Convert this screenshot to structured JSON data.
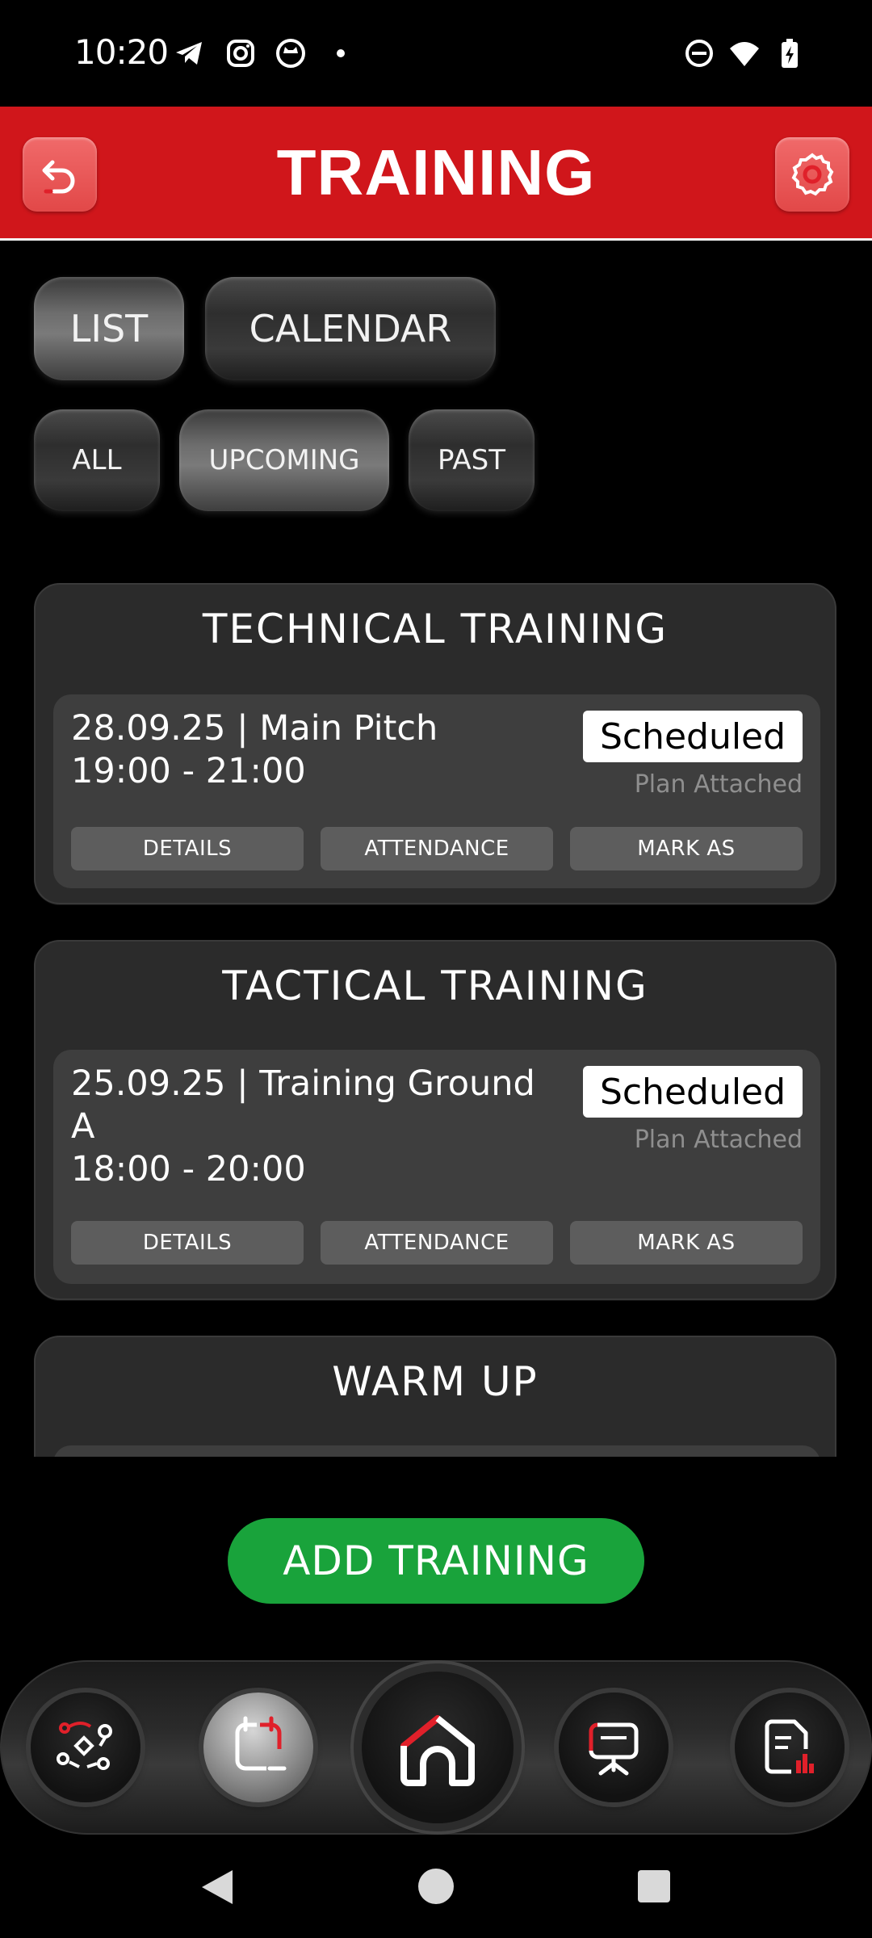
{
  "status_bar": {
    "time": "10:20"
  },
  "header": {
    "title": "TRAINING"
  },
  "view_toggle": {
    "list": "LIST",
    "calendar": "CALENDAR"
  },
  "filters": {
    "all": "ALL",
    "upcoming": "UPCOMING",
    "past": "PAST"
  },
  "trainings": [
    {
      "title": "TECHNICAL TRAINING",
      "date_location": "28.09.25 | Main Pitch",
      "time": "19:00 - 21:00",
      "status": "Scheduled",
      "plan": "Plan Attached",
      "buttons": {
        "details": "DETAILS",
        "attendance": "ATTENDANCE",
        "mark_as": "MARK AS"
      }
    },
    {
      "title": "TACTICAL TRAINING",
      "date_location": "25.09.25 | Training Ground",
      "date_location_cont": "A",
      "time": "18:00 - 20:00",
      "status": "Scheduled",
      "plan": "Plan Attached",
      "buttons": {
        "details": "DETAILS",
        "attendance": "ATTENDANCE",
        "mark_as": "MARK AS"
      }
    },
    {
      "title": "WARM UP"
    }
  ],
  "add_training": "ADD TRAINING",
  "icons": {
    "back": "back-arrow-icon",
    "settings": "gear-icon",
    "nav": [
      "tactics-icon",
      "schedule-icon",
      "home-icon",
      "presentation-icon",
      "report-icon"
    ]
  },
  "colors": {
    "header_red": "#d0161b",
    "accent_red": "#e0202a",
    "add_green": "#19a33b"
  }
}
